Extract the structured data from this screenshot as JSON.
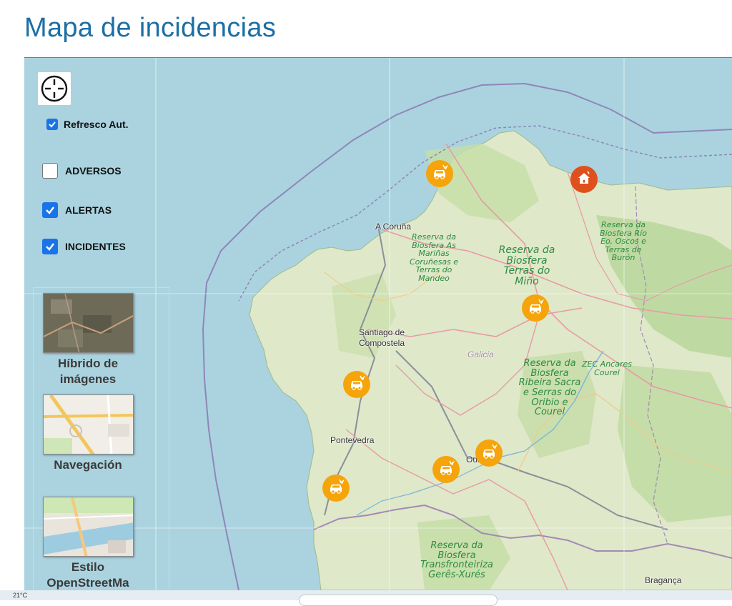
{
  "page": {
    "title": "Mapa de incidencias"
  },
  "controls": {
    "locate_icon": "crosshair-icon",
    "auto_refresh": {
      "label": "Refresco Aut.",
      "checked": true
    },
    "filters": [
      {
        "id": "adversos",
        "label": "ADVERSOS",
        "checked": false
      },
      {
        "id": "alertas",
        "label": "ALERTAS",
        "checked": true
      },
      {
        "id": "incidentes",
        "label": "INCIDENTES",
        "checked": true
      }
    ]
  },
  "layers": [
    {
      "label": "Híbrido de imágenes"
    },
    {
      "label": "Navegación"
    },
    {
      "label": "Estilo OpenStreetMa"
    }
  ],
  "map": {
    "places": [
      "A Coruña",
      "Santiago de Compostela",
      "Pontevedra",
      "Ourense",
      "Bragança",
      "Galicia"
    ],
    "reserves": [
      "Reserva da Biosfera As Mariñas Coruñesas e Terras do Mandeo",
      "Reserva da Biosfera Terras do Miño",
      "Reserva da Biosfera Río Eo, Oscos e Terras de Burón",
      "Reserva da Biosfera Ribeira Sacra e Serras do Oribio e Courel",
      "ZEC Ancares Courel",
      "Reserva da Biosfera Transfronteiriza Gerês-Xurés"
    ],
    "markers": [
      {
        "type": "alert",
        "icon": "car-crash-icon",
        "color": "#f5a40b"
      },
      {
        "type": "adverse",
        "icon": "house-fire-icon",
        "color": "#e0501c"
      }
    ]
  },
  "taskbar": {
    "weather": "21°C"
  }
}
